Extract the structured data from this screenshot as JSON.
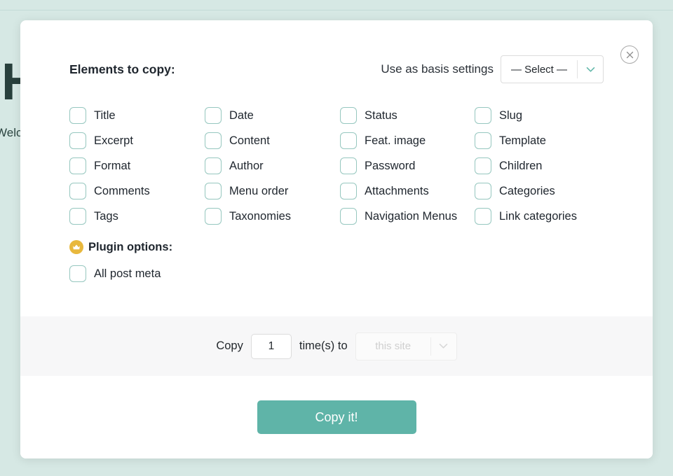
{
  "backdrop": {
    "heading": "Hello",
    "subtext": "Welcome to the site"
  },
  "modal": {
    "close_icon_label": "×",
    "header": {
      "title": "Elements to copy:",
      "basis_label": "Use as basis settings",
      "basis_select_value": "— Select —"
    },
    "elements": [
      {
        "label": "Title",
        "checked": false
      },
      {
        "label": "Date",
        "checked": false
      },
      {
        "label": "Status",
        "checked": false
      },
      {
        "label": "Slug",
        "checked": false
      },
      {
        "label": "Excerpt",
        "checked": false
      },
      {
        "label": "Content",
        "checked": false
      },
      {
        "label": "Feat. image",
        "checked": false
      },
      {
        "label": "Template",
        "checked": false
      },
      {
        "label": "Format",
        "checked": false
      },
      {
        "label": "Author",
        "checked": false
      },
      {
        "label": "Password",
        "checked": false
      },
      {
        "label": "Children",
        "checked": false
      },
      {
        "label": "Comments",
        "checked": false
      },
      {
        "label": "Menu order",
        "checked": false
      },
      {
        "label": "Attachments",
        "checked": false
      },
      {
        "label": "Categories",
        "checked": false
      },
      {
        "label": "Tags",
        "checked": false
      },
      {
        "label": "Taxonomies",
        "checked": false
      },
      {
        "label": "Navigation Menus",
        "checked": false
      },
      {
        "label": "Link categories",
        "checked": false
      }
    ],
    "plugin_options": {
      "heading": "Plugin options:",
      "badge_icon": "crown-icon",
      "items": [
        {
          "label": "All post meta",
          "checked": false
        }
      ]
    },
    "copy_strip": {
      "prefix": "Copy",
      "times_value": "1",
      "suffix": "time(s) to",
      "destination_placeholder": "this site",
      "destination_disabled": true
    },
    "submit_label": "Copy it!"
  },
  "colors": {
    "page_background": "#d6e8e4",
    "accent_teal": "#5fb4a8",
    "checkbox_border": "#96c7bf",
    "crown_gold": "#e8b83d",
    "strip_background": "#f7f7f8"
  }
}
